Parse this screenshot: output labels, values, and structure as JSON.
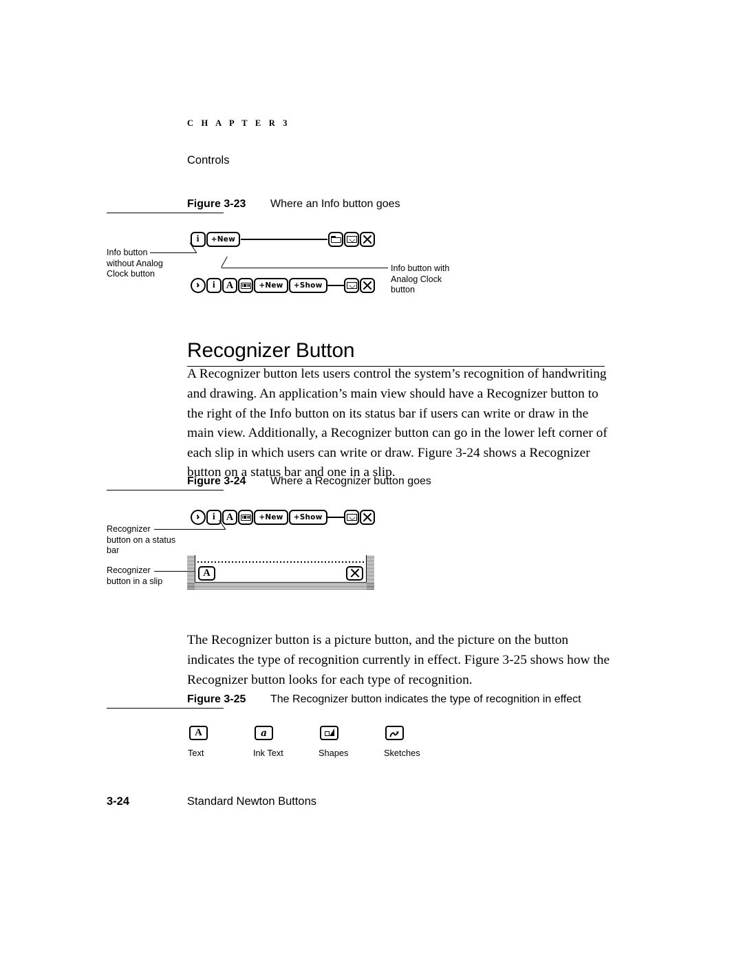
{
  "page": {
    "chapter_header": "C H A P T E R   3",
    "chapter_title": "Controls",
    "folio": "3-24",
    "footer_title": "Standard Newton Buttons"
  },
  "heading": {
    "recognizer_button": "Recognizer Button"
  },
  "figures": [
    {
      "label": "Figure 3-23",
      "caption": "Where an Info button goes",
      "callouts": [
        "Info button\nwithout Analog\nClock button",
        "Info button with\nAnalog Clock\nbutton"
      ],
      "statusbars": [
        {
          "name": "statusbar-without-clock",
          "buttons": [
            "info-icon",
            "+New",
            "folder-icon",
            "envelope-icon",
            "close-icon"
          ]
        },
        {
          "name": "statusbar-with-clock",
          "buttons": [
            "clock-icon",
            "info-icon",
            "recognizer-a-icon",
            "keyboard-icon",
            "+New",
            "+Show",
            "envelope-icon",
            "close-icon"
          ]
        }
      ]
    },
    {
      "label": "Figure 3-24",
      "caption": "Where a Recognizer button goes",
      "callouts": [
        "Recognizer\nbutton on a status\nbar",
        "Recognizer\nbutton in a slip"
      ],
      "statusbar": {
        "buttons": [
          "clock-icon",
          "info-icon",
          "recognizer-a-icon",
          "keyboard-icon",
          "+New",
          "+Show",
          "envelope-icon",
          "close-icon"
        ]
      },
      "slip": {
        "recognizer_button": "A",
        "close_button": "close-icon"
      }
    },
    {
      "label": "Figure 3-25",
      "caption": "The Recognizer button indicates the type of recognition in effect",
      "icons": [
        {
          "glyph": "A",
          "label": "Text",
          "name": "recognizer-text-icon"
        },
        {
          "glyph": "a",
          "label": "Ink Text",
          "name": "recognizer-ink-text-icon"
        },
        {
          "glyph": "shapes",
          "label": "Shapes",
          "name": "recognizer-shapes-icon"
        },
        {
          "glyph": "sketch",
          "label": "Sketches",
          "name": "recognizer-sketches-icon"
        }
      ]
    }
  ],
  "buttons": {
    "new": "+New",
    "show": "+Show"
  },
  "paragraphs": {
    "p1": "A Recognizer button lets users control the system’s recognition of handwriting and drawing. An application’s main view should have a Recognizer button to the right of the Info button on its status bar if users can write or draw in the main view. Additionally, a Recognizer button can go in the lower left corner of each slip in which users can write or draw. Figure 3-24 shows a Recognizer button on a status bar and one in a slip.",
    "p2": "The Recognizer button is a picture button, and the picture on the button indicates the type of recognition currently in effect. Figure 3-25 shows how the Recognizer button looks for each type of recognition."
  },
  "colors": {
    "text": "#000000",
    "background": "#ffffff"
  }
}
